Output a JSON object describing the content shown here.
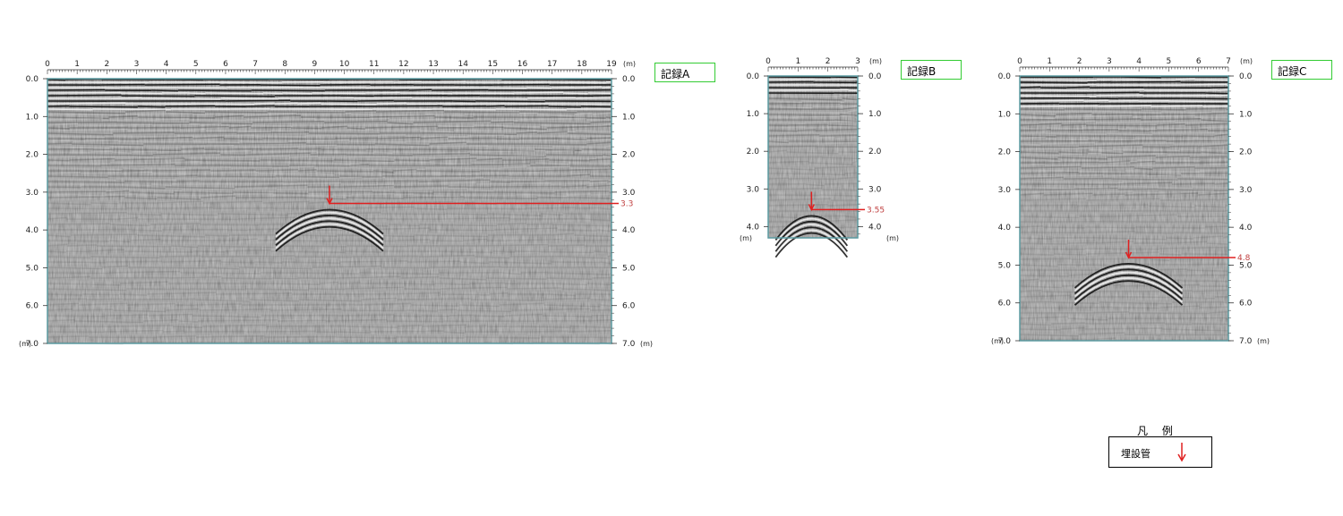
{
  "unit_label": "(m)",
  "records": [
    {
      "id": "A",
      "label": "記録A",
      "x_ticks": [
        "0",
        "1",
        "2",
        "3",
        "4",
        "5",
        "6",
        "7",
        "8",
        "9",
        "10",
        "11",
        "12",
        "13",
        "14",
        "15",
        "16",
        "17",
        "18",
        "19"
      ],
      "depth_ticks": [
        "0.0",
        "1.0",
        "2.0",
        "3.0",
        "4.0",
        "5.0",
        "6.0",
        "7.0"
      ],
      "x_range": [
        0,
        19
      ],
      "depth_range": [
        0,
        7
      ],
      "pipe_marker": {
        "x": 9.5,
        "depth": 3.3,
        "label": "3.3"
      }
    },
    {
      "id": "B",
      "label": "記録B",
      "x_ticks": [
        "0",
        "1",
        "2",
        "3"
      ],
      "depth_ticks": [
        "0.0",
        "1.0",
        "2.0",
        "3.0",
        "4.0"
      ],
      "x_range": [
        0,
        3
      ],
      "depth_range": [
        0,
        4.3
      ],
      "pipe_marker": {
        "x": 1.45,
        "depth": 3.55,
        "label": "3.55"
      }
    },
    {
      "id": "C",
      "label": "記録C",
      "x_ticks": [
        "0",
        "1",
        "2",
        "3",
        "4",
        "5",
        "6",
        "7"
      ],
      "depth_ticks": [
        "0.0",
        "1.0",
        "2.0",
        "3.0",
        "4.0",
        "5.0",
        "6.0",
        "7.0"
      ],
      "x_range": [
        0,
        7
      ],
      "depth_range": [
        0,
        7
      ],
      "pipe_marker": {
        "x": 3.65,
        "depth": 4.8,
        "label": "4.8"
      }
    }
  ],
  "legend": {
    "title": "凡 例",
    "item_label": "埋設管",
    "marker_color": "#e02020"
  },
  "colors": {
    "marker": "#e02020",
    "frame": "#5a9aa0",
    "label_border": "#33cc33"
  }
}
